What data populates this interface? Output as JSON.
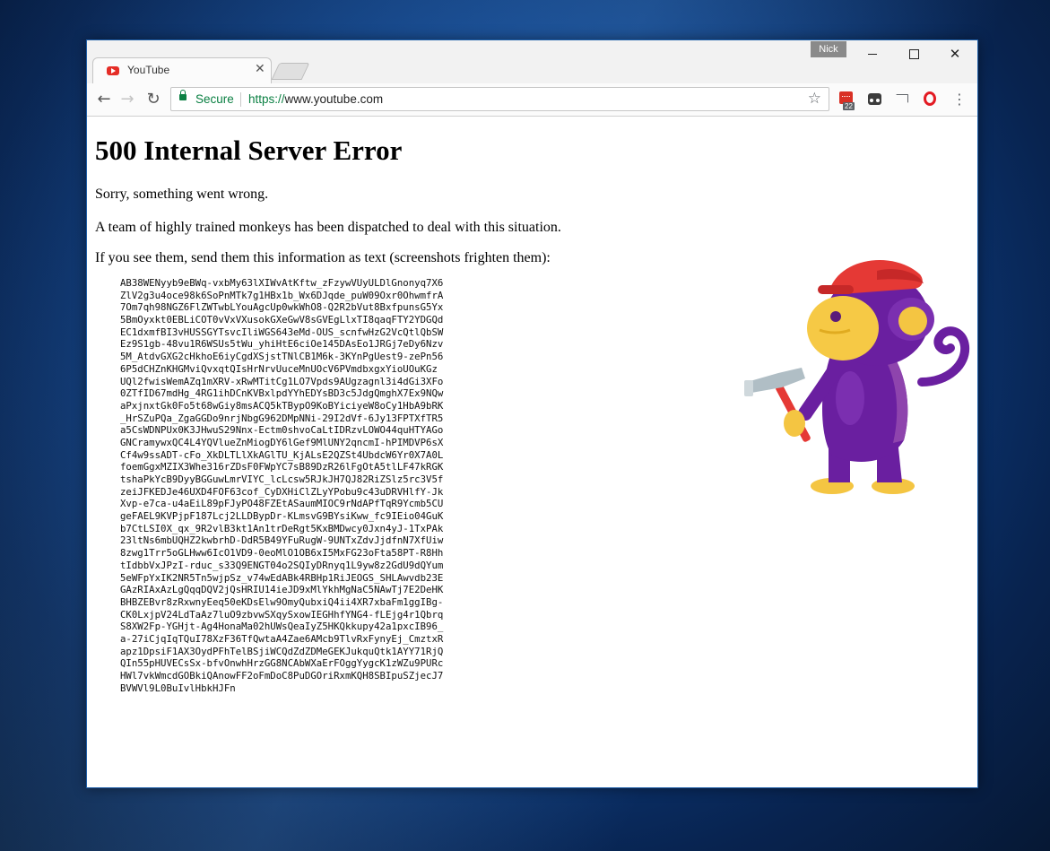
{
  "window": {
    "user_badge": "Nick",
    "tab": {
      "title": "YouTube"
    }
  },
  "toolbar": {
    "secure_label": "Secure",
    "url_scheme": "https://",
    "url_host": "www.youtube.com",
    "todoist_badge": "22"
  },
  "page": {
    "title": "500 Internal Server Error",
    "line1": "Sorry, something went wrong.",
    "line2": "A team of highly trained monkeys has been dispatched to deal with this situation.",
    "line3": "If you see them, send them this information as text (screenshots frighten them):",
    "error_blob": [
      "AB38WENyyb9eBWq-vxbMy63lXIWvAtKftw_zFzywVUyULDlGnonyq7X6",
      "ZlV2g3u4oce98k6SoPnMTk7g1HBx1b_Wx6DJqde_puW09Oxr0OhwmfrA",
      "7Om7qh98NGZ6FlZWTwbLYouAgcUp0wkWhO8-Q2R2bVut8BxfpunsG5Yx",
      "5BmOyxkt0EBLiCOT0vVxVXusokGXeGwV8sGVEgLlxTI8qaqFTY2YDGQd",
      "EC1dxmfBI3vHUSSGYTsvcIliWGS643eMd-OUS_scnfwHzG2VcQtlQbSW",
      "Ez9S1gb-48vu1R6WSUs5tWu_yhiHtE6ciOe145DAsEo1JRGj7eDy6Nzv",
      "5M_AtdvGXG2cHkhoE6iyCgdXSjstTNlCB1M6k-3KYnPgUest9-zePn56",
      "6P5dCHZnKHGMviQvxqtQIsHrNrvUuceMnUOcV6PVmdbxgxYioUOuKGz",
      "UQl2fwisWemAZq1mXRV-xRwMTitCg1LO7Vpds9AUgzagnl3i4dGi3XFo",
      "0ZTfID67mdHg_4RG1ihDCnKVBxlpdYYhEDYsBD3c5JdgQmghX7Ex9NQw",
      "aPxjnxtGk0Fo5t68wGiy8msACQ5kTBypO9KoBYiciyeW8oCy1HbA9bRK",
      "_HrSZuPQa_ZgaGGDo9nrjNbgG962DMpNNi-29I2dVf-6Jy13FPTXfTR5",
      "a5CsWDNPUx0K3JHwuS29Nnx-Ectm0shvoCaLtIDRzvLOWO44quHTYAGo",
      "GNCramywxQC4L4YQVlueZnMiogDY6lGef9MlUNY2qncmI-hPIMDVP6sX",
      "Cf4w9ssADT-cFo_XkDLTLlXkAGlTU_KjALsE2QZSt4UbdcW6Yr0X7A0L",
      "foemGgxMZIX3Whe316rZDsF0FWpYC7sB89DzR26lFgOtA5tlLF47kRGK",
      "tshaPkYcB9DyyBGGuwLmrVIYC_lcLcsw5RJkJH7QJ82RiZSlz5rc3V5f",
      "zeiJFKEDJe46UXD4FOF63cof_CyDXHiClZLyYPobu9c43uDRVHlfY-Jk",
      "Xvp-e7ca-u4aEiL89pFJyPO48FZEtASaumMIOC9rNdAPfTqR9Ycmb5CU",
      "geFAEL9KVPjpF187Lcj2LLDBypDr-KLmsvG9BYsiKww_fc9IEio04GuK",
      "b7CtLSI0X_qx_9R2vlB3kt1An1trDeRgt5KxBMDwcy0Jxn4yJ-1TxPAk",
      "23ltNs6mbUQHZ2kwbrhD-DdR5B49YFuRugW-9UNTxZdvJjdfnN7XfUiw",
      "8zwg1Trr5oGLHww6IcO1VD9-0eoMlO1OB6xI5MxFG23oFta58PT-R8Hh",
      "tIdbbVxJPzI-rduc_s33Q9ENGT04o2SQIyDRnyq1L9yw8z2GdU9dQYum",
      "5eWFpYxIK2NR5Tn5wjpSz_v74wEdABk4RBHp1RiJEOGS_SHLAwvdb23E",
      "GAzRIAxAzLgQqqDQV2jQsHRIU14ieJD9xMlYkhMgNaC5NAwTj7E2DeHK",
      "BHBZEBvr8zRxwnyEeq50eKDsElw9OmyQubxiQ4ii4XR7xbaFm1ggIBg-",
      "CK0LxjpV24LdTaAz7luO9zbvwSXqySxowIEGHhfYNG4-fLEjg4r1Qbrq",
      "S8XW2Fp-YGHjt-Ag4HonaMa02hUWsQeaIyZ5HKQkkupy42a1pxcIB96_",
      "a-27iCjqIqTQuI78XzF36TfQwtaA4Zae6AMcb9TlvRxFynyEj_CmztxR",
      "apz1DpsiF1AX3OydPFhTelBSjiWCQdZdZDMeGEKJukquQtk1AYY71RjQ",
      "QIn55pHUVECsSx-bfvOnwhHrzGG8NCAbWXaErFOggYygcK1zWZu9PURc",
      "HWl7vkWmcdGOBkiQAnowFF2oFmDoC8PuDGOriRxmKQH8SBIpuSZjecJ7",
      "BVWVl9L0BuIvlHbkHJFn"
    ]
  },
  "colors": {
    "secure_green": "#0b8043",
    "monkey_purple": "#6a1fa0",
    "cap_red": "#e53935",
    "face_yellow": "#f6c945"
  }
}
